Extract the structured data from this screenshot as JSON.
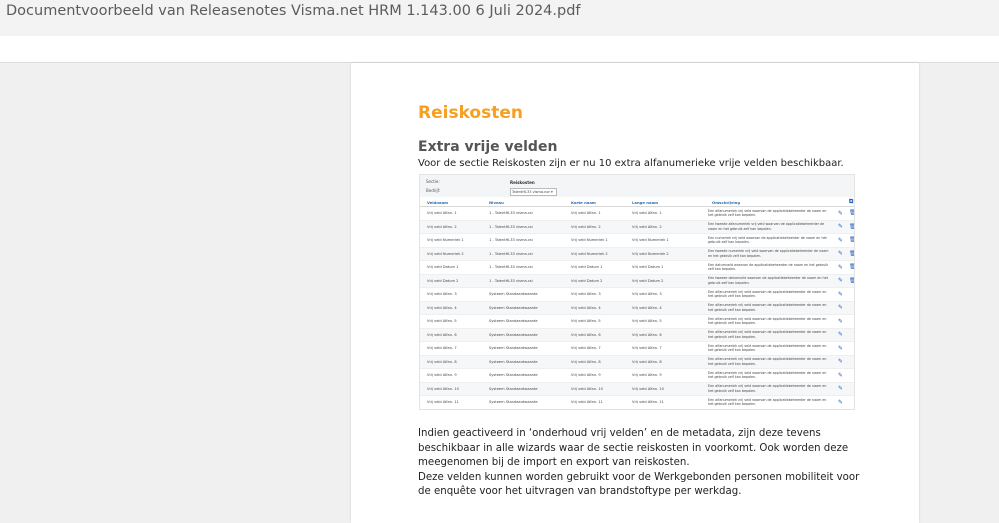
{
  "window": {
    "title": "Documentvoorbeeld van Releasenotes Visma.net HRM 1.143.00 6 Juli 2024.pdf"
  },
  "doc": {
    "heading": "Reiskosten",
    "subheading": "Extra vrije velden",
    "intro": "Voor de sectie Reiskosten zijn er nu 10 extra alfanumerieke vrije velden beschikbaar.",
    "paragraph1": "Indien geactiveerd in ‘onderhoud vrij velden’ en de metadata, zijn deze tevens beschikbaar in alle wizards waar de sectie reiskosten in voorkomt. Ook worden deze meegenomen bij de import en export van reiskosten.",
    "paragraph2": "Deze velden kunnen worden gebruikt voor de Werkgebonden personen mobiliteit voor de enquête voor het uitvragen van brandstoftype per werkdag."
  },
  "screenshot": {
    "filter_label_sectie": "Sectie:",
    "filter_label_bedrijf": "Bedrijf:",
    "filter_title": "Reiskosten",
    "filter_value": "TalentHL33 vlsma.nor",
    "columns": [
      "Veldnaam",
      "Niveau",
      "Korte naam",
      "Lange naam",
      "Omschrijving"
    ],
    "rows": [
      {
        "veld": "Vrij veld Alfan. 1",
        "niveau": "1 - TalentHL33 visma.csi",
        "kort": "Vrij veld Alfan. 1",
        "lang": "Vrij veld Alfan. 1",
        "desc": "Een alfanumeriek vrij veld waarvan de applicatiebeheerder de naam en het gebruik zelf kan bepalen.",
        "icon": "trash"
      },
      {
        "veld": "Vrij veld Alfan. 2",
        "niveau": "1 - TalentHL33 visma.csi",
        "kort": "Vrij veld Alfan. 2",
        "lang": "Vrij veld Alfan. 2",
        "desc": "Een tweede alfanumeriek vrij veld waarvan de applicatiebeheerder de naam en het gebruik zelf kan bepalen.",
        "icon": "trash"
      },
      {
        "veld": "Vrij veld Numeriek 1",
        "niveau": "1 - TalentHL33 visma.csi",
        "kort": "Vrij veld Numeriek 1",
        "lang": "Vrij veld Numeriek 1",
        "desc": "Een numeriek vrij veld waarvan de applicatiebeheerder de naam en het gebruik zelf kan bepalen.",
        "icon": "trash"
      },
      {
        "veld": "Vrij veld Numeriek 2",
        "niveau": "1 - TalentHL33 visma.csi",
        "kort": "Vrij veld Numeriek 2",
        "lang": "Vrij veld Numeriek 2",
        "desc": "Een tweede numeriek vrij veld waarvan de applicatiebeheerder de naam en het gebruik zelf kan bepalen.",
        "icon": "trash"
      },
      {
        "veld": "Vrij veld Datum 1",
        "niveau": "1 - TalentHL33 visma.csi",
        "kort": "Vrij veld Datum 1",
        "lang": "Vrij veld Datum 1",
        "desc": "Een datumveld waarvan de applicatiebeheerder de naam en het gebruik zelf kan bepalen.",
        "icon": "trash"
      },
      {
        "veld": "Vrij veld Datum 2",
        "niveau": "1 - TalentHL33 visma.csi",
        "kort": "Vrij veld Datum 2",
        "lang": "Vrij veld Datum 2",
        "desc": "Een tweede datumveld waarvan de applicatiebeheerder de naam en het gebruik zelf kan bepalen.",
        "icon": "trash"
      },
      {
        "veld": "Vrij veld Alfan. 3",
        "niveau": "Systeem Standaardwaarde",
        "kort": "Vrij veld Alfan. 3",
        "lang": "Vrij veld Alfan. 3",
        "desc": "Een alfanumeriek vrij veld waarvan de applicatiebeheerder de naam en het gebruik zelf kan bepalen.",
        "icon": ""
      },
      {
        "veld": "Vrij veld Alfan. 4",
        "niveau": "Systeem Standaardwaarde",
        "kort": "Vrij veld Alfan. 4",
        "lang": "Vrij veld Alfan. 4",
        "desc": "Een alfanumeriek vrij veld waarvan de applicatiebeheerder de naam en het gebruik zelf kan bepalen.",
        "icon": ""
      },
      {
        "veld": "Vrij veld Alfan. 5",
        "niveau": "Systeem Standaardwaarde",
        "kort": "Vrij veld Alfan. 5",
        "lang": "Vrij veld Alfan. 5",
        "desc": "Een alfanumeriek vrij veld waarvan de applicatiebeheerder de naam en het gebruik zelf kan bepalen.",
        "icon": ""
      },
      {
        "veld": "Vrij veld Alfan. 6",
        "niveau": "Systeem Standaardwaarde",
        "kort": "Vrij veld Alfan. 6",
        "lang": "Vrij veld Alfan. 6",
        "desc": "Een alfanumeriek vrij veld waarvan de applicatiebeheerder de naam en het gebruik zelf kan bepalen.",
        "icon": ""
      },
      {
        "veld": "Vrij veld Alfan. 7",
        "niveau": "Systeem Standaardwaarde",
        "kort": "Vrij veld Alfan. 7",
        "lang": "Vrij veld Alfan. 7",
        "desc": "Een alfanumeriek vrij veld waarvan de applicatiebeheerder de naam en het gebruik zelf kan bepalen.",
        "icon": ""
      },
      {
        "veld": "Vrij veld Alfan. 8",
        "niveau": "Systeem Standaardwaarde",
        "kort": "Vrij veld Alfan. 8",
        "lang": "Vrij veld Alfan. 8",
        "desc": "Een alfanumeriek vrij veld waarvan de applicatiebeheerder de naam en het gebruik zelf kan bepalen.",
        "icon": ""
      },
      {
        "veld": "Vrij veld Alfan. 9",
        "niveau": "Systeem Standaardwaarde",
        "kort": "Vrij veld Alfan. 9",
        "lang": "Vrij veld Alfan. 9",
        "desc": "Een alfanumeriek vrij veld waarvan de applicatiebeheerder de naam en het gebruik zelf kan bepalen.",
        "icon": ""
      },
      {
        "veld": "Vrij veld Alfan. 10",
        "niveau": "Systeem Standaardwaarde",
        "kort": "Vrij veld Alfan. 10",
        "lang": "Vrij veld Alfan. 10",
        "desc": "Een alfanumeriek vrij veld waarvan de applicatiebeheerder de naam en het gebruik zelf kan bepalen.",
        "icon": ""
      },
      {
        "veld": "Vrij veld Alfan. 11",
        "niveau": "Systeem Standaardwaarde",
        "kort": "Vrij veld Alfan. 11",
        "lang": "Vrij veld Alfan. 11",
        "desc": "Een alfanumeriek vrij veld waarvan de applicatiebeheerder de naam en het gebruik zelf kan bepalen.",
        "icon": ""
      },
      {
        "veld": "Vrij veld Alfan. 12",
        "niveau": "Systeem Standaardwaarde",
        "kort": "Vrij veld Alfan. 12",
        "lang": "Vrij veld Alfan. 12",
        "desc": "Een alfanumeriek vrij veld waarvan de applicatiebeheerder de naam en het gebruik zelf kan bepalen.",
        "icon": ""
      }
    ]
  },
  "colors": {
    "heading": "#f5a020",
    "link_blue": "#2b6cb0"
  },
  "icons": {
    "edit": "pencil-icon",
    "delete": "trash-icon",
    "copy": "copy-icon"
  }
}
